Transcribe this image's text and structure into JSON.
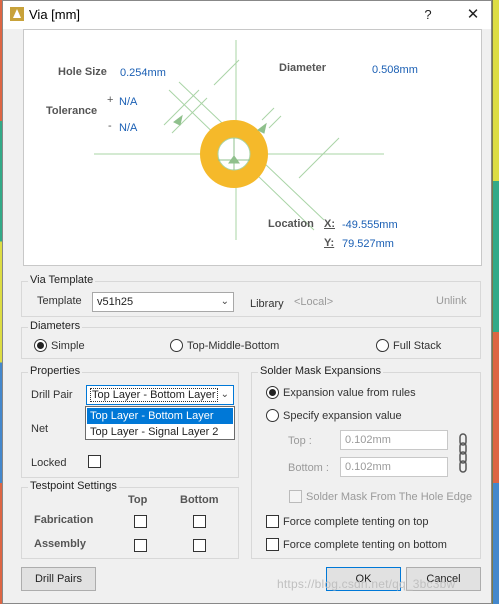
{
  "window": {
    "title": "Via [mm]",
    "help": "?",
    "close": "✕"
  },
  "preview": {
    "hole_size_label": "Hole Size",
    "hole_size_value": "0.254mm",
    "tolerance_label": "Tolerance",
    "tol_plus_sign": "+",
    "tol_plus_value": "N/A",
    "tol_minus_sign": "-",
    "tol_minus_value": "N/A",
    "diameter_label": "Diameter",
    "diameter_value": "0.508mm",
    "location_label": "Location",
    "x_label": "X:",
    "x_value": "-49.555mm",
    "y_label": "Y:",
    "y_value": "79.527mm",
    "colors": {
      "pad": "#f5b92a",
      "guide": "#a9d4a6"
    }
  },
  "via_template": {
    "legend": "Via Template",
    "template_label": "Template",
    "template_value": "v51h25",
    "library_label": "Library",
    "library_value": "<Local>",
    "unlink": "Unlink"
  },
  "diameters": {
    "legend": "Diameters",
    "simple": "Simple",
    "top_middle_bottom": "Top-Middle-Bottom",
    "full_stack": "Full Stack",
    "selected": "Simple"
  },
  "properties": {
    "legend": "Properties",
    "drill_pair_label": "Drill Pair",
    "drill_pair_value": "Top Layer - Bottom Layer",
    "drill_pair_options": [
      "Top Layer - Bottom Layer",
      "Top Layer - Signal Layer 2"
    ],
    "net_label": "Net",
    "locked_label": "Locked"
  },
  "testpoint": {
    "legend": "Testpoint Settings",
    "col_top": "Top",
    "col_bottom": "Bottom",
    "row_fabrication": "Fabrication",
    "row_assembly": "Assembly"
  },
  "solder_mask": {
    "legend": "Solder Mask Expansions",
    "from_rules": "Expansion value from rules",
    "specify": "Specify expansion value",
    "top_label": "Top :",
    "top_value": "0.102mm",
    "bottom_label": "Bottom :",
    "bottom_value": "0.102mm",
    "from_hole_edge": "Solder Mask From The Hole Edge",
    "tenting_top": "Force complete tenting on top",
    "tenting_bottom": "Force complete tenting on bottom"
  },
  "footer": {
    "drill_pairs": "Drill Pairs",
    "ok": "OK",
    "cancel": "Cancel"
  },
  "watermark": "https://blog.csdn.net/qq_3bc3bw"
}
